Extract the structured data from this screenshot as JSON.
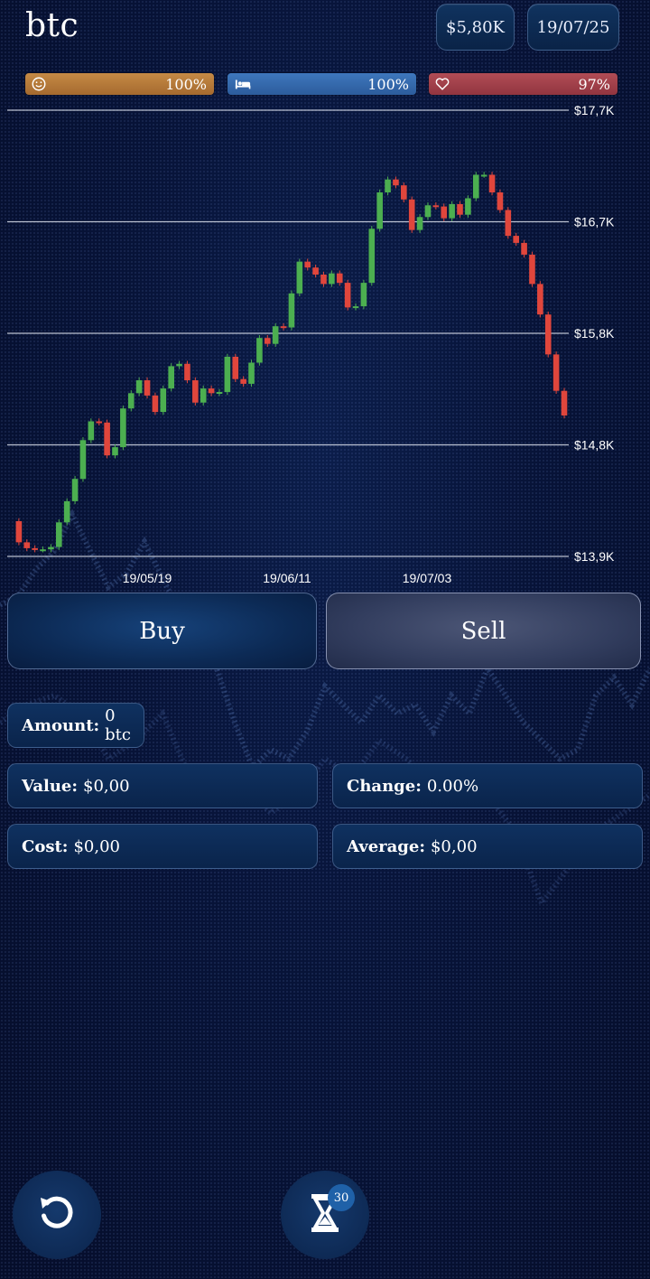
{
  "header": {
    "ticker": "btc",
    "cash_label": "$5,80K",
    "date_label": "19/07/25"
  },
  "meters": {
    "mood": {
      "icon": "smiley-icon",
      "value": "100%",
      "color": "#b87a3a"
    },
    "rest": {
      "icon": "bed-icon",
      "value": "100%",
      "color": "#3569ab"
    },
    "health": {
      "icon": "heart-icon",
      "value": "97%",
      "color": "#a0414b"
    }
  },
  "chart_data": {
    "type": "candlestick",
    "y_ticks": [
      "$17,7K",
      "$16,7K",
      "$15,8K",
      "$14,8K",
      "$13,9K"
    ],
    "x_ticks": [
      "19/05/19",
      "19/06/11",
      "19/07/03"
    ],
    "ylim": [
      13900,
      17700
    ],
    "grid": "horizontal",
    "up_color": "#4caf50",
    "down_color": "#e0463c",
    "close_series": [
      14200,
      14020,
      13970,
      13960,
      13960,
      13980,
      14190,
      14370,
      14560,
      14890,
      15050,
      15040,
      14760,
      14830,
      15160,
      15290,
      15400,
      15270,
      15130,
      15330,
      15520,
      15540,
      15400,
      15210,
      15330,
      15290,
      15300,
      15600,
      15410,
      15370,
      15550,
      15760,
      15710,
      15860,
      15850,
      16140,
      16410,
      16360,
      16300,
      16220,
      16310,
      16230,
      16020,
      16030,
      16230,
      16690,
      17000,
      17110,
      17060,
      16940,
      16680,
      16790,
      16890,
      16880,
      16780,
      16900,
      16810,
      16950,
      17150,
      17150,
      17000,
      16850,
      16630,
      16570,
      16470,
      16220,
      15960,
      15620,
      15310,
      15100
    ]
  },
  "actions": {
    "buy_label": "Buy",
    "sell_label": "Sell"
  },
  "stats": {
    "amount_label": "Amount:",
    "amount_value": "0 btc",
    "value_label": "Value:",
    "value_value": "$0,00",
    "change_label": "Change:",
    "change_value": "0.00%",
    "cost_label": "Cost:",
    "cost_value": "$0,00",
    "average_label": "Average:",
    "average_value": "$0,00"
  },
  "footer": {
    "undo_icon": "undo-icon",
    "wait_icon": "hourglass-icon",
    "wait_badge": "30"
  }
}
